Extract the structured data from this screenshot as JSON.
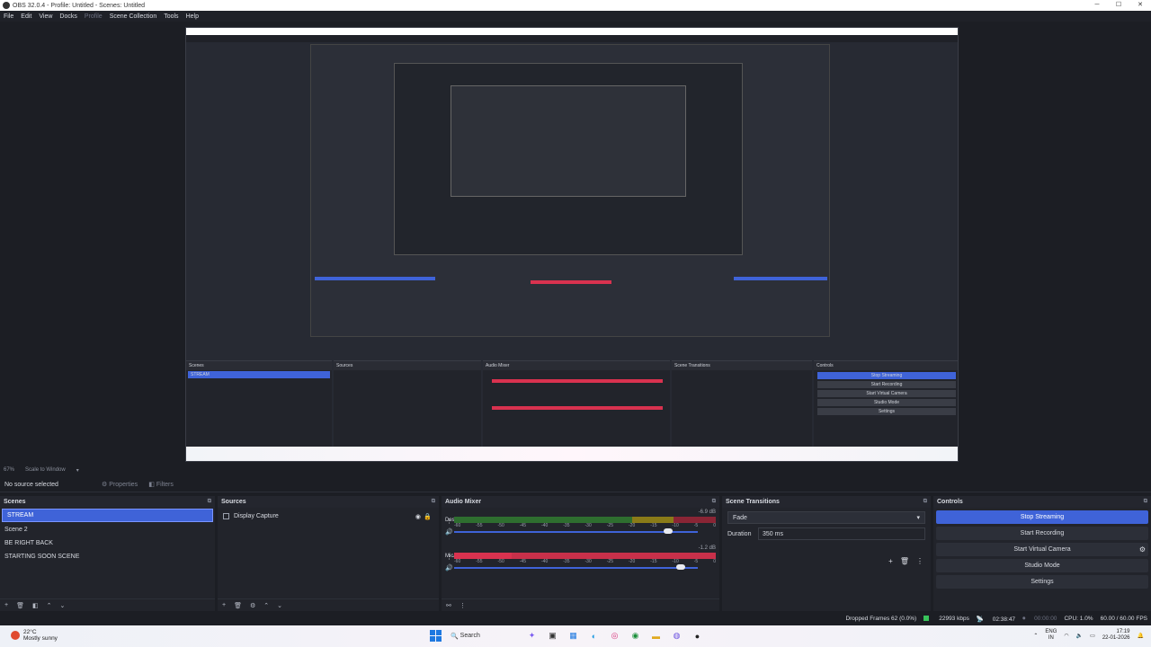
{
  "window": {
    "title": "OBS 32.0.4 - Profile: Untitled - Scenes: Untitled",
    "controls": [
      "─",
      "☐",
      "✕"
    ]
  },
  "menu": [
    "File",
    "Edit",
    "View",
    "Docks",
    "Profile",
    "Scene Collection",
    "Tools",
    "Help"
  ],
  "scale": {
    "zoom": "67%",
    "mode": "Scale to Window"
  },
  "source_toolbar": {
    "selected": "No source selected",
    "properties": "Properties",
    "filters": "Filters"
  },
  "scenes": {
    "title": "Scenes",
    "items": [
      "STREAM",
      "Scene 2",
      "BE RIGHT BACK",
      "STARTING SOON SCENE"
    ],
    "selected_index": 0
  },
  "sources": {
    "title": "Sources",
    "items": [
      {
        "name": "Display Capture"
      }
    ]
  },
  "audio_mixer": {
    "title": "Audio Mixer",
    "channels": [
      {
        "name": "Desktop Audio",
        "db": "-6.9 dB",
        "volume": 0.88
      },
      {
        "name": "Mic/Aux",
        "db": "-1.2 dB",
        "volume": 0.93
      }
    ],
    "ticks": [
      "-60",
      "-55",
      "-50",
      "-45",
      "-40",
      "-35",
      "-30",
      "-25",
      "-20",
      "-15",
      "-10",
      "-5",
      "0"
    ]
  },
  "scene_transitions": {
    "title": "Scene Transitions",
    "transition": "Fade",
    "duration_label": "Duration",
    "duration_value": "350 ms"
  },
  "controls": {
    "title": "Controls",
    "buttons": [
      "Stop Streaming",
      "Start Recording",
      "Start Virtual Camera",
      "Studio Mode",
      "Settings"
    ]
  },
  "status": {
    "dropped": "Dropped Frames 62 (0.0%)",
    "bitrate": "22993 kbps",
    "stream_time": "02:38:47",
    "rec_time": "00:00:00",
    "cpu": "CPU: 1.0%",
    "fps": "60.00 / 60.00 FPS"
  },
  "taskbar": {
    "weather_temp": "22°C",
    "weather_desc": "Mostly sunny",
    "search": "Search",
    "lang": "ENG",
    "region": "IN",
    "time": "17:19",
    "date": "22-01-2026"
  },
  "colors": {
    "accent": "#3f63d8",
    "meter_red": "#d9324f",
    "meter_green": "#2e7d32",
    "meter_yellow": "#9a8b1c",
    "bg": "#1c1e24",
    "dock": "#22242b"
  }
}
